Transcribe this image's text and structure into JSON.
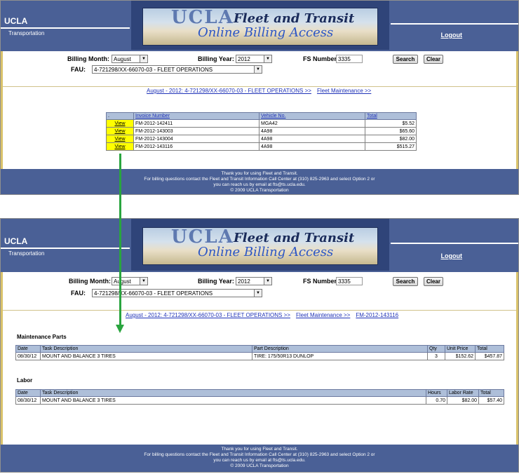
{
  "brand": {
    "name": "UCLA",
    "sub": "Transportation",
    "banner_ucla": "UCLA",
    "banner_fleet": "Fleet and Transit",
    "banner_online": "Online Billing Access",
    "logout": "Logout"
  },
  "form": {
    "billing_month_label": "Billing Month:",
    "billing_month_value": "August",
    "billing_year_label": "Billing Year:",
    "billing_year_value": "2012",
    "fs_number_label": "FS Number",
    "fs_number_value": "3335",
    "search_label": "Search",
    "clear_label": "Clear",
    "fau_label": "FAU:",
    "fau_value": "4-721298/XX-66070-03 - FLEET OPERATIONS"
  },
  "screen1": {
    "crumb1": "August - 2012: 4-721298/XX-66070-03 - FLEET OPERATIONS >>",
    "crumb2": "Fleet Maintenance >>",
    "table": {
      "headers": {
        "h0": ".",
        "h1": "Invoice Number",
        "h2": "Vehicle No.",
        "h3": "Total"
      },
      "rows": [
        {
          "view": "View",
          "invoice": "FM-2012-142411",
          "vehicle": "MGA42",
          "total": "$5.52"
        },
        {
          "view": "View",
          "invoice": "FM-2012-143003",
          "vehicle": "4A98",
          "total": "$65.60"
        },
        {
          "view": "View",
          "invoice": "FM-2012-143004",
          "vehicle": "4A98",
          "total": "$82.00"
        },
        {
          "view": "View",
          "invoice": "FM-2012-143116",
          "vehicle": "4A98",
          "total": "$515.27"
        }
      ]
    }
  },
  "screen2": {
    "crumb1": "August - 2012: 4-721298/XX-66070-03 - FLEET OPERATIONS >>",
    "crumb2": "Fleet Maintenance >>",
    "crumb3": "FM-2012-143116",
    "parts": {
      "title": "Maintenance Parts",
      "headers": {
        "date": "Date",
        "task": "Task Description",
        "part": "Part Description",
        "qty": "Qty",
        "unit": "Unit Price",
        "total": "Total"
      },
      "row": {
        "date": "08/30/12",
        "task": "MOUNT AND BALANCE 3 TIRES",
        "part": "TIRE: 175/50R13 DUNLOP",
        "qty": "3",
        "unit": "$152.62",
        "total": "$457.87"
      }
    },
    "labor": {
      "title": "Labor",
      "headers": {
        "date": "Date",
        "task": "Task Description",
        "hours": "Hours",
        "rate": "Labor Rate",
        "total": "Total"
      },
      "row": {
        "date": "08/30/12",
        "task": "MOUNT AND BALANCE 3 TIRES",
        "hours": "0.70",
        "rate": "$82.00",
        "total": "$57.40"
      }
    }
  },
  "footer": {
    "line1": "Thank you for using Fleet and Transit.",
    "line2": "For billing questions contact the Fleet and Transit Information Call Center at (310) 825-2963 and select Option 2 or",
    "line3": "you can reach us by email at fts@ts.ucla.edu.",
    "line4": "© 2009 UCLA Transportation"
  },
  "colors": {
    "header": "#4a6096",
    "accent_border": "#d9c26a",
    "view_highlight": "#ffff00",
    "arrow": "#2aa53f"
  }
}
